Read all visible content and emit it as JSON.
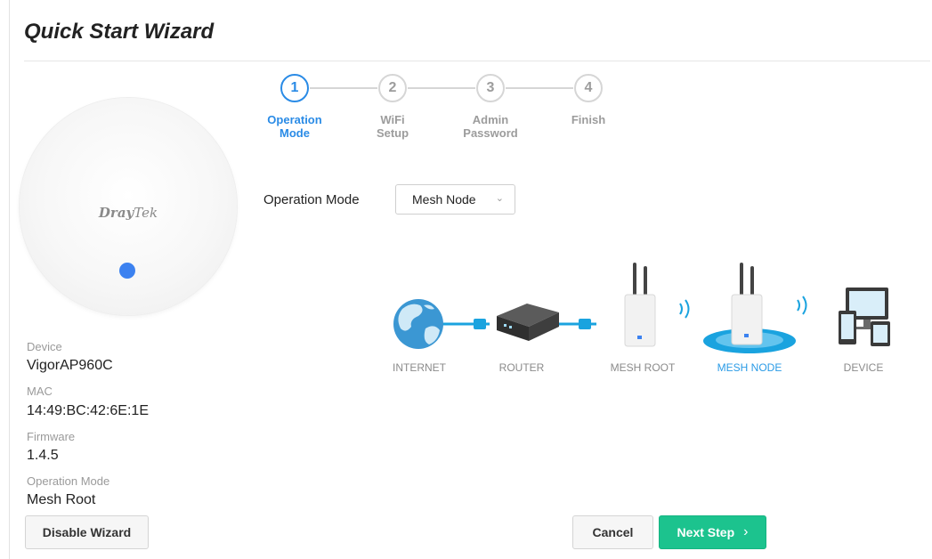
{
  "page": {
    "title": "Quick Start Wizard"
  },
  "device_panel": {
    "logo_bold": "Dray",
    "logo_light": "Tek",
    "device_label": "Device",
    "device_value": "VigorAP960C",
    "mac_label": "MAC",
    "mac_value": "14:49:BC:42:6E:1E",
    "firmware_label": "Firmware",
    "firmware_value": "1.4.5",
    "mode_label": "Operation Mode",
    "mode_value": "Mesh Root",
    "status_color": "#3c82f0"
  },
  "steps": [
    {
      "number": "1",
      "label": "Operation\nMode",
      "active": true
    },
    {
      "number": "2",
      "label": "WiFi\nSetup",
      "active": false
    },
    {
      "number": "3",
      "label": "Admin\nPassword",
      "active": false
    },
    {
      "number": "4",
      "label": "Finish",
      "active": false
    }
  ],
  "form": {
    "operation_mode_label": "Operation Mode",
    "operation_mode_value": "Mesh Node",
    "caret_icon": "chevron-down-icon"
  },
  "diagram": {
    "labels": {
      "internet": "INTERNET",
      "router": "ROUTER",
      "mesh_root": "MESH ROOT",
      "mesh_node": "MESH NODE",
      "device": "DEVICE"
    },
    "highlight_color": "#2a9be6"
  },
  "buttons": {
    "disable_wizard": "Disable Wizard",
    "cancel": "Cancel",
    "next_step": "Next Step",
    "next_icon": "chevron-right-icon"
  },
  "colors": {
    "accent": "#2a8be6",
    "primary_button": "#1cc38e"
  }
}
